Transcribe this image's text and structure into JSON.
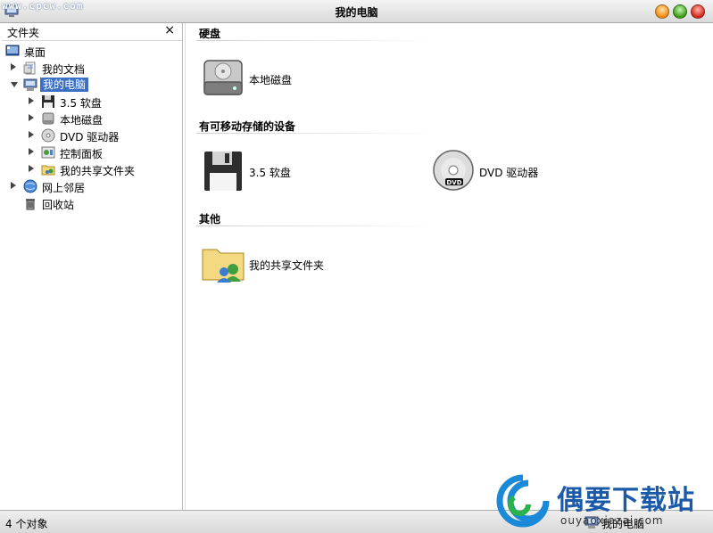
{
  "window": {
    "title": "我的电脑",
    "watermark_text": "www.cpcw.com"
  },
  "sidebar": {
    "header_label": "文件夹",
    "close_glyph": "×",
    "items": [
      {
        "label": "桌面",
        "icon": "desktop-icon",
        "indent": 0,
        "expander": "none"
      },
      {
        "label": "我的文档",
        "icon": "documents-icon",
        "indent": 1,
        "expander": "collapsed"
      },
      {
        "label": "我的电脑",
        "icon": "computer-icon",
        "indent": 1,
        "expander": "expanded",
        "selected": true
      },
      {
        "label": "3.5 软盘",
        "icon": "floppy-icon",
        "indent": 2,
        "expander": "collapsed"
      },
      {
        "label": "本地磁盘",
        "icon": "hard-disk-icon",
        "indent": 2,
        "expander": "collapsed"
      },
      {
        "label": "DVD 驱动器",
        "icon": "dvd-icon",
        "indent": 2,
        "expander": "collapsed"
      },
      {
        "label": "控制面板",
        "icon": "control-panel-icon",
        "indent": 2,
        "expander": "collapsed"
      },
      {
        "label": "我的共享文件夹",
        "icon": "shared-folder-icon",
        "indent": 2,
        "expander": "collapsed"
      },
      {
        "label": "网上邻居",
        "icon": "network-icon",
        "indent": 1,
        "expander": "collapsed"
      },
      {
        "label": "回收站",
        "icon": "trash-icon",
        "indent": 1,
        "expander": "none"
      }
    ]
  },
  "main": {
    "sections": [
      {
        "title": "硬盘",
        "items": [
          {
            "label": "本地磁盘",
            "icon": "hard-disk-icon"
          }
        ]
      },
      {
        "title": "有可移动存储的设备",
        "items": [
          {
            "label": "3.5 软盘",
            "icon": "floppy-icon"
          },
          {
            "label": "DVD 驱动器",
            "icon": "dvd-icon"
          }
        ]
      },
      {
        "title": "其他",
        "items": [
          {
            "label": "我的共享文件夹",
            "icon": "shared-folder-icon"
          }
        ]
      }
    ]
  },
  "statusbar": {
    "object_count": "4 个对象",
    "location": "我的电脑"
  },
  "branding": {
    "site_name": "偶要下载站",
    "site_domain": "ouyaoxiazai.com"
  },
  "colors": {
    "selection": "#3a6fc4",
    "brand_blue": "#1a5aa8"
  }
}
